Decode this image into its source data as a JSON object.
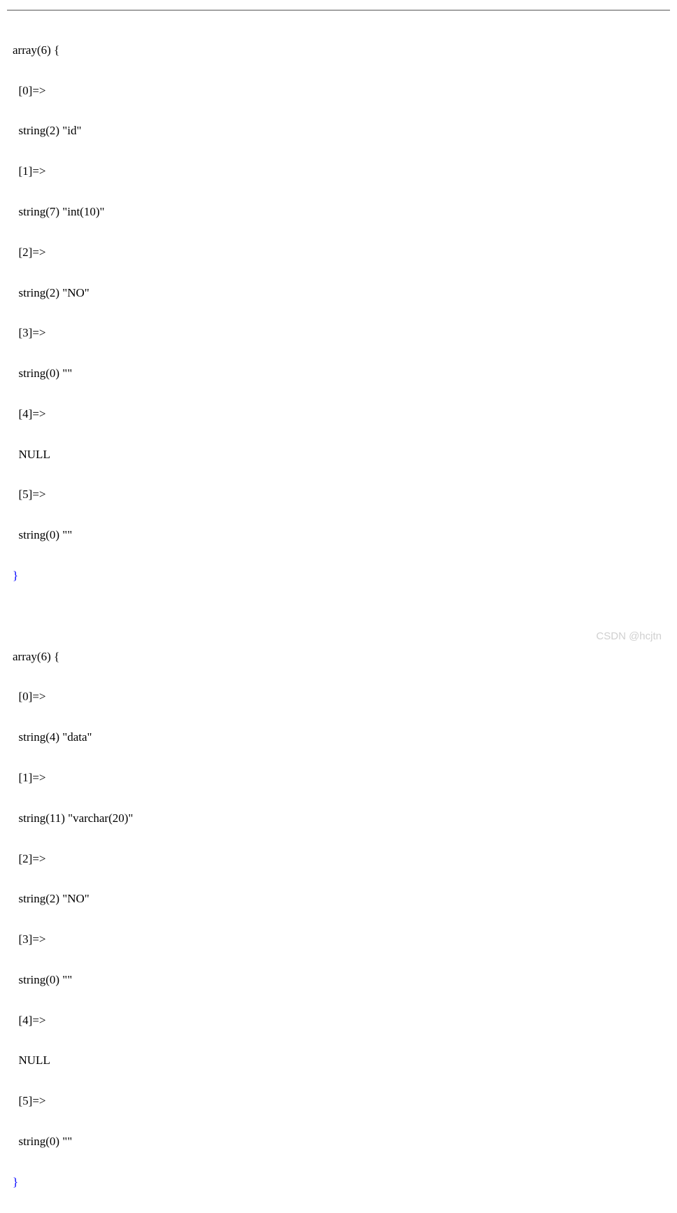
{
  "blocks": [
    {
      "header": "array(6) {",
      "entries": [
        {
          "index": "[0]=>",
          "value": "string(2) \"id\""
        },
        {
          "index": "[1]=>",
          "value": "string(7) \"int(10)\""
        },
        {
          "index": "[2]=>",
          "value": "string(2) \"NO\""
        },
        {
          "index": "[3]=>",
          "value": "string(0) \"\""
        },
        {
          "index": "[4]=>",
          "value": "NULL"
        },
        {
          "index": "[5]=>",
          "value": "string(0) \"\""
        }
      ],
      "footer": "}"
    },
    {
      "header": "array(6) {",
      "entries": [
        {
          "index": "[0]=>",
          "value": "string(4) \"data\""
        },
        {
          "index": "[1]=>",
          "value": "string(11) \"varchar(20)\""
        },
        {
          "index": "[2]=>",
          "value": "string(2) \"NO\""
        },
        {
          "index": "[3]=>",
          "value": "string(0) \"\""
        },
        {
          "index": "[4]=>",
          "value": "NULL"
        },
        {
          "index": "[5]=>",
          "value": "string(0) \"\""
        }
      ],
      "footer": "}"
    }
  ],
  "watermark": "CSDN @hcjtn"
}
